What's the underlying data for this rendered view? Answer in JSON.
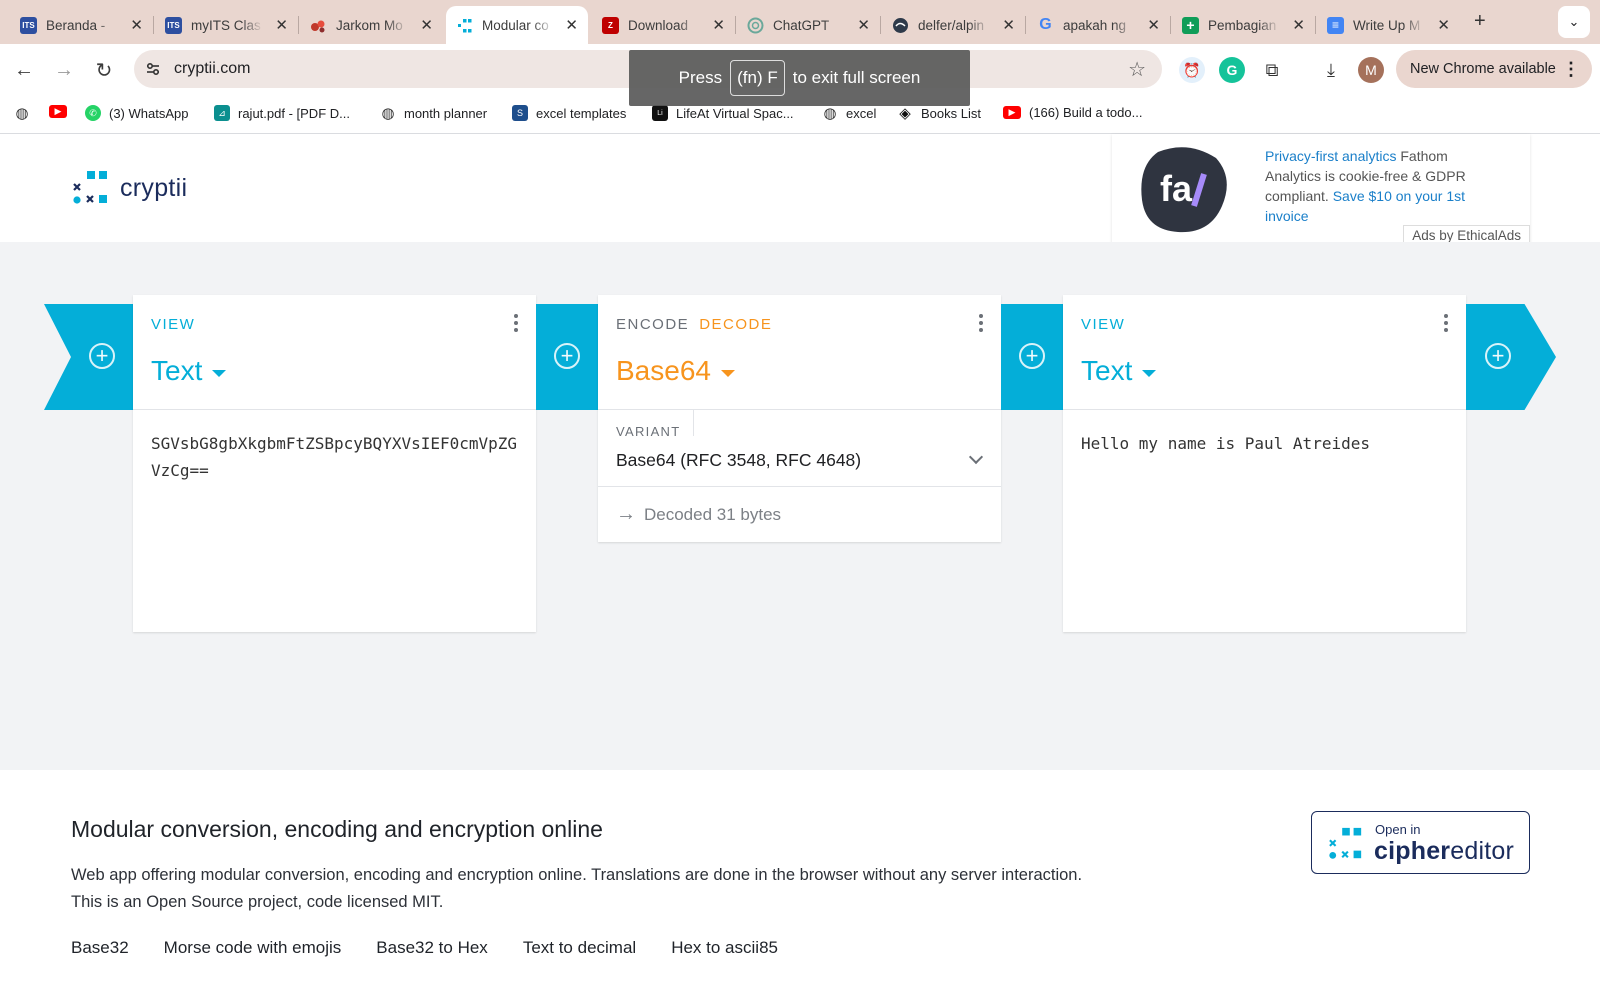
{
  "browser": {
    "tabs": [
      {
        "title": "Beranda - ",
        "favicon_color": "#2d4fa0",
        "favicon_text": "ITS"
      },
      {
        "title": "myITS Clas",
        "favicon_color": "#2d4fa0",
        "favicon_text": "ITS"
      },
      {
        "title": "Jarkom Mo",
        "favicon_color": "#c0392b",
        "favicon_text": ""
      },
      {
        "title": "Modular co",
        "favicon_color": "#04aed8",
        "favicon_text": ""
      },
      {
        "title": "Download",
        "favicon_color": "#bf0000",
        "favicon_text": "Z"
      },
      {
        "title": "ChatGPT",
        "favicon_color": "#6aa89a",
        "favicon_text": ""
      },
      {
        "title": "delfer/alpin",
        "favicon_color": "#2e3a4a",
        "favicon_text": ""
      },
      {
        "title": "apakah ng",
        "favicon_color": "#4285f4",
        "favicon_text": "G"
      },
      {
        "title": "Pembagian",
        "favicon_color": "#0f9d58",
        "favicon_text": "+"
      },
      {
        "title": "Write Up M",
        "favicon_color": "#4285f4",
        "favicon_text": "≡"
      }
    ],
    "new_tab": "+",
    "url": "cryptii.com",
    "fullscreen_toast": {
      "before": "Press",
      "key": "(fn) F",
      "after": "to exit full screen"
    },
    "update_button": "New Chrome available",
    "profile_initial": "M",
    "bookmarks": [
      {
        "label": "",
        "icon": "globe-icon"
      },
      {
        "label": "",
        "icon": "youtube-icon"
      },
      {
        "label": "(3) WhatsApp",
        "icon": "whatsapp-icon"
      },
      {
        "label": "rajut.pdf - [PDF D...",
        "icon": "pdf-icon"
      },
      {
        "label": "month planner",
        "icon": "globe-icon"
      },
      {
        "label": "excel templates",
        "icon": "spreadsheet-icon"
      },
      {
        "label": "LifeAt Virtual Spac...",
        "icon": "lifeat-icon"
      },
      {
        "label": "excel",
        "icon": "globe-icon"
      },
      {
        "label": "Books List",
        "icon": "diamond-icon"
      },
      {
        "label": "(166) Build a todo...",
        "icon": "youtube-icon"
      }
    ]
  },
  "header": {
    "logo_text": "cryptii",
    "ad": {
      "logo_text": "fa/",
      "link1": "Privacy-first analytics",
      "text1": " Fathom Analytics is cookie-free & GDPR compliant. ",
      "link2": "Save $10 on your 1st invoice",
      "by": "Ads by EthicalAds"
    }
  },
  "pipeline": {
    "input_brick": {
      "category": "VIEW",
      "title": "Text",
      "content": "SGVsbG8gbXkgbmFtZSBpcyBQYXVsIEF0cmVpZGVzCg=="
    },
    "encoder_brick": {
      "category_encode": "ENCODE",
      "category_decode": "DECODE",
      "title": "Base64",
      "variant_label": "VARIANT",
      "variant_value": "Base64 (RFC 3548, RFC 4648)",
      "status": "Decoded 31 bytes"
    },
    "output_brick": {
      "category": "VIEW",
      "title": "Text",
      "content": "Hello my name is Paul Atreides"
    }
  },
  "footer": {
    "heading": "Modular conversion, encoding and encryption online",
    "description": "Web app offering modular conversion, encoding and encryption online. Translations are done in the browser without any server interaction. This is an Open Source project, code licensed MIT.",
    "links": [
      "Base32",
      "Morse code with emojis",
      "Base32 to Hex",
      "Text to decimal",
      "Hex to ascii85"
    ],
    "open_in": "Open in",
    "cipher_a": "cipher",
    "cipher_b": "editor"
  },
  "colors": {
    "accent": "#04aed8",
    "orange": "#f7941d",
    "navy": "#1b2c5c",
    "tabstrip": "#e9d6cf"
  }
}
